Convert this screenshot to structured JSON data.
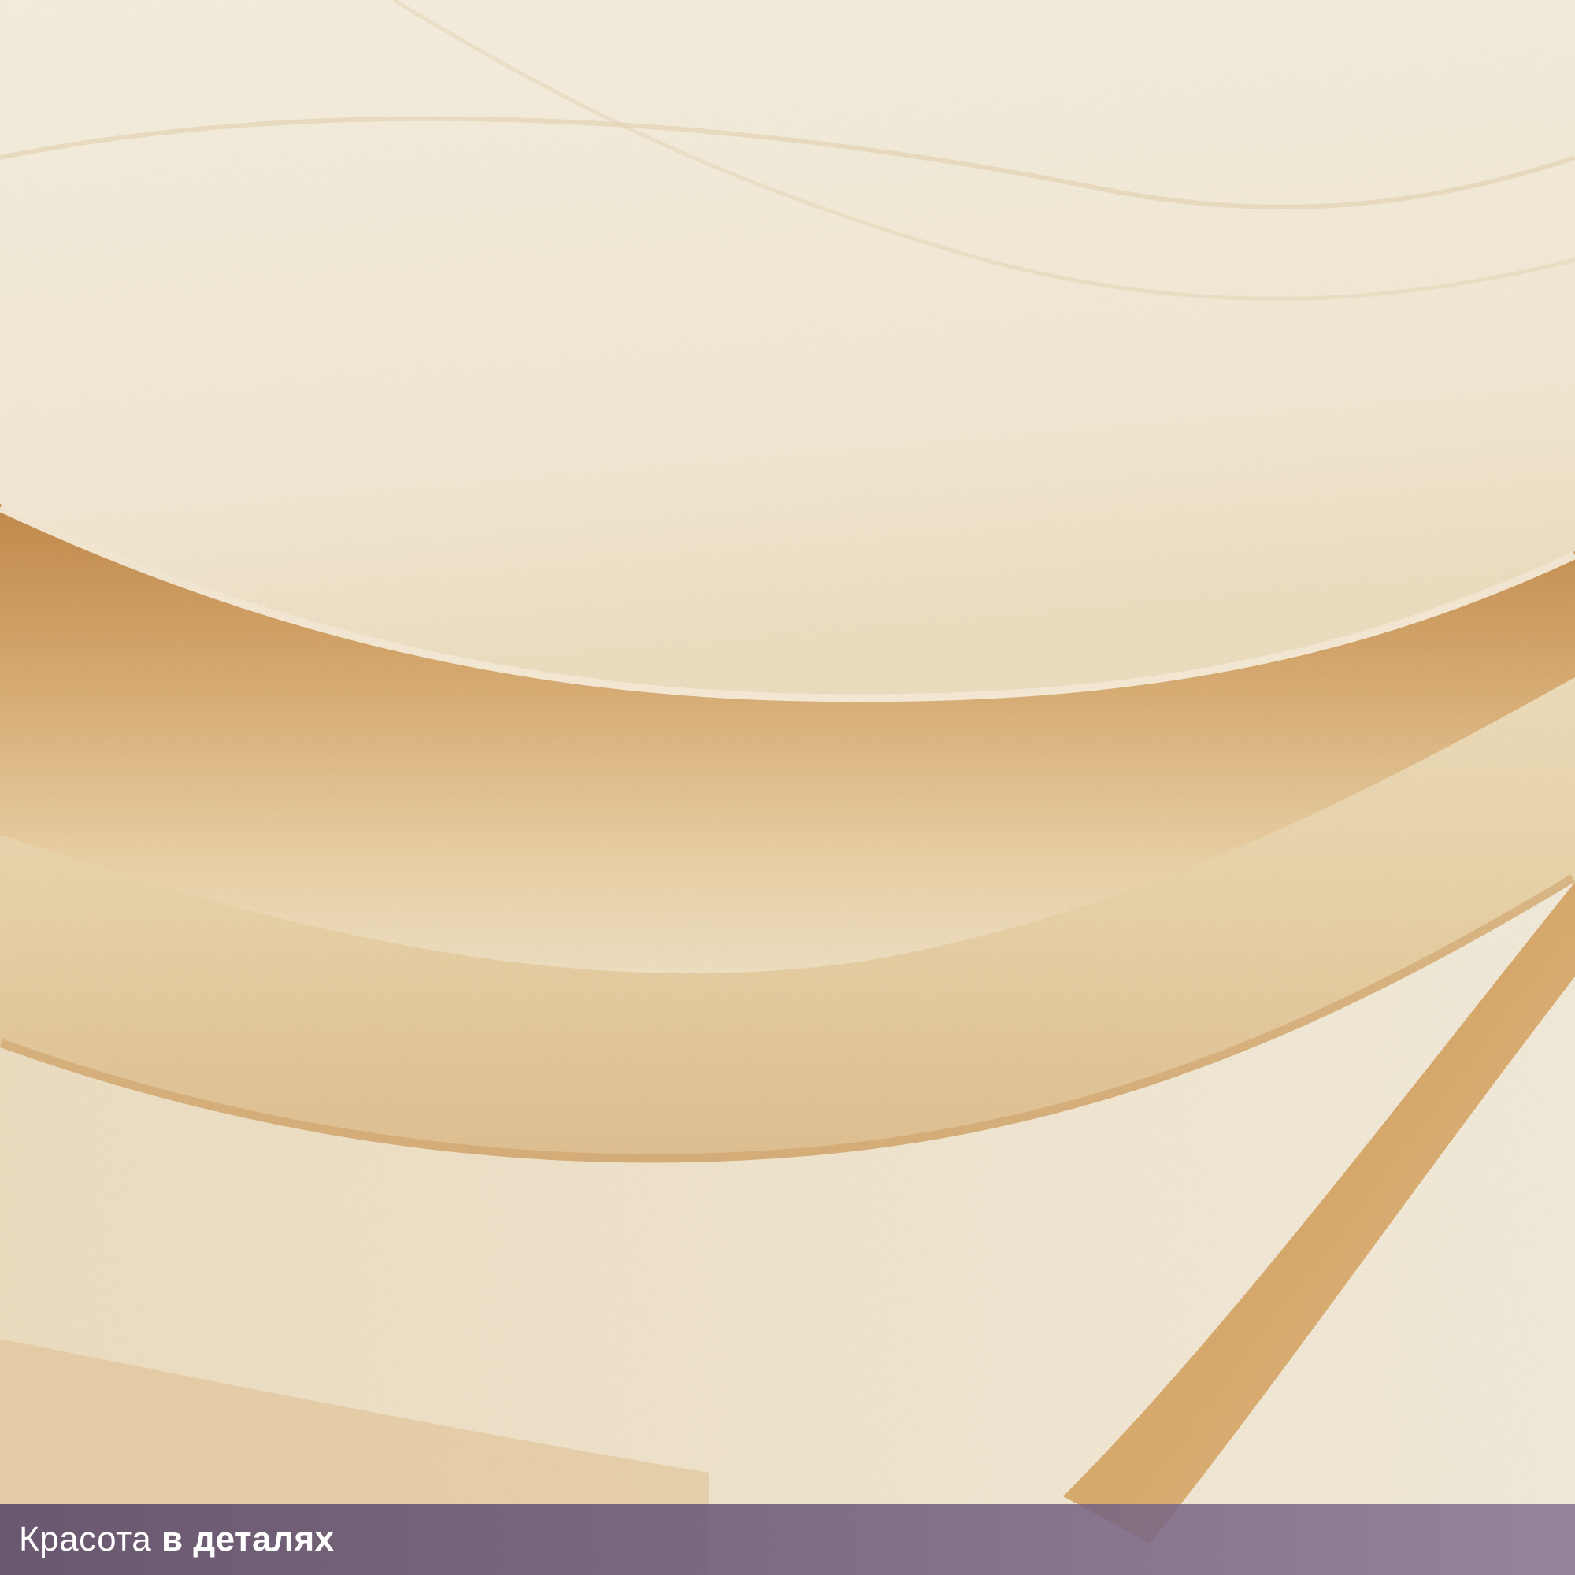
{
  "photo": {
    "subject": "textured-fabric-waves",
    "colors": {
      "cream": "#f4ead6",
      "light": "#fbf6ea",
      "tan": "#e4c79a",
      "ochre": "#c8904e",
      "shadow": "#b07a3e",
      "caption_bar": "#6e5c7c"
    }
  },
  "caption": {
    "text_regular": "Красота",
    "text_bold": "в деталях"
  }
}
